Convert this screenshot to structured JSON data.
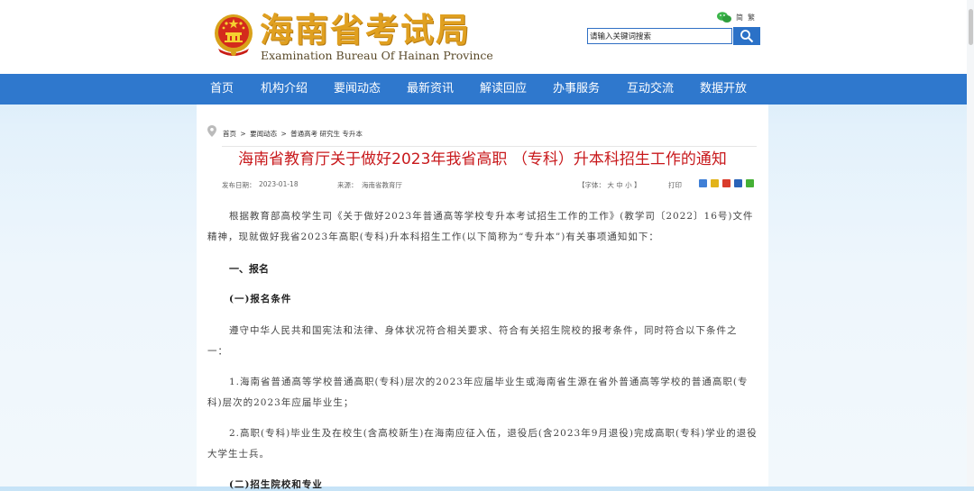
{
  "site": {
    "name_cn": "海南省考试局",
    "name_en": "Examination Bureau Of Hainan Province",
    "lang_label": "简繁"
  },
  "search": {
    "value": "请输入关键词搜索"
  },
  "nav": {
    "items": [
      "首页",
      "机构介绍",
      "要闻动态",
      "最新资讯",
      "解读回应",
      "办事服务",
      "互动交流",
      "数据开放"
    ]
  },
  "breadcrumb": [
    "首页",
    ">",
    "要闻动态",
    ">",
    "普通高考 研究生 专升本"
  ],
  "article": {
    "title": "海南省教育厅关于做好2023年我省高职 （专科）升本科招生工作的通知",
    "date_label": "发布日期：",
    "date": "2023-01-18",
    "source_label": "来源：",
    "source": "海南省教育厅",
    "font_size_label": "【字体：  大   中   小  】",
    "print_label": "打印",
    "paragraphs": [
      "根据教育部高校学生司《关于做好2023年普通高等学校专升本考试招生工作的工作》(教学司〔2022〕16号)文件精神，现就做好我省2023年高职(专科)升本科招生工作(以下简称为“专升本”)有关事项通知如下：",
      "遵守中华人民共和国宪法和法律、身体状况符合相关要求、符合有关招生院校的报考条件，同时符合以下条件之一：",
      "1.海南省普通高等学校普通高职(专科)层次的2023年应届毕业生或海南省生源在省外普通高等学校的普通高职(专科)层次的2023年应届毕业生；",
      "2.高职(专科)毕业生及在校生(含高校新生)在海南应征入伍，退役后(含2023年9月退役)完成高职(专科)学业的退役大学生士兵。"
    ],
    "heading1": "一、报名",
    "heading2": "(一)报名条件",
    "heading3": "(二)招生院校和专业"
  },
  "colors": {
    "nav_bg": "#2f78cd",
    "title_red": "#c8191c",
    "brand_gold": "#e0a020"
  },
  "icons": [
    "national-emblem-icon",
    "wechat-icon",
    "search-icon",
    "location-pin-icon",
    "share-icons"
  ]
}
